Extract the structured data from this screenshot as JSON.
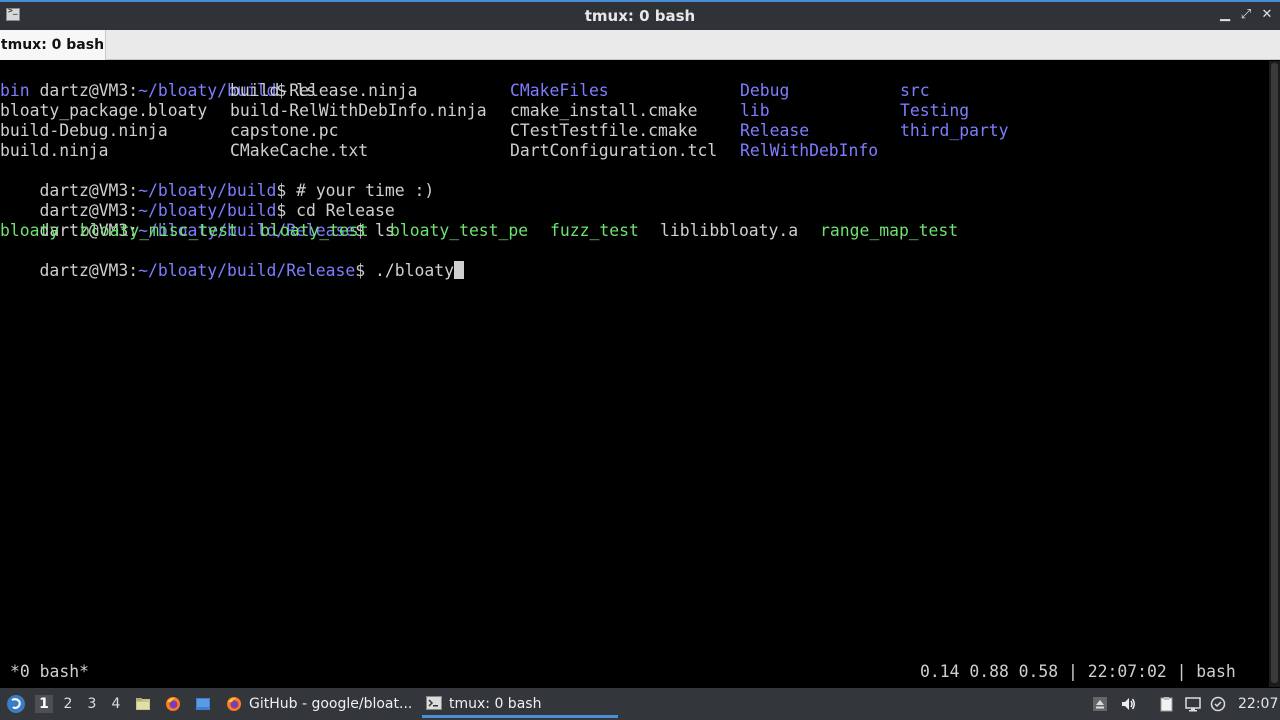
{
  "window": {
    "title": "tmux: 0 bash"
  },
  "tab": {
    "label": "tmux: 0 bash"
  },
  "terminal": {
    "prompt1": {
      "user": "dartz@VM3",
      "sep": ":",
      "path": "~/bloaty/build",
      "sign": "$ ",
      "cmd": "ls"
    },
    "ls_build": [
      [
        "bin",
        "build-Release.ninja",
        "CMakeFiles",
        "Debug",
        "src"
      ],
      [
        "bloaty_package.bloaty",
        "build-RelWithDebInfo.ninja",
        "cmake_install.cmake",
        "lib",
        "Testing"
      ],
      [
        "build-Debug.ninja",
        "capstone.pc",
        "CTestTestfile.cmake",
        "Release",
        "third_party"
      ],
      [
        "build.ninja",
        "CMakeCache.txt",
        "DartConfiguration.tcl",
        "RelWithDebInfo",
        ""
      ]
    ],
    "prompt2": {
      "user": "dartz@VM3",
      "sep": ":",
      "path": "~/bloaty/build",
      "sign": "$ ",
      "cmd": "# your time :)"
    },
    "prompt3": {
      "user": "dartz@VM3",
      "sep": ":",
      "path": "~/bloaty/build",
      "sign": "$ ",
      "cmd": "cd Release"
    },
    "prompt4": {
      "user": "dartz@VM3",
      "sep": ":",
      "path": "~/bloaty/build/Release",
      "sign": "$ ",
      "cmd": "ls"
    },
    "ls_release": [
      "bloaty",
      "bloaty_misc_test",
      "bloaty_test",
      "bloaty_test_pe",
      "fuzz_test",
      "liblibbloaty.a",
      "range_map_test"
    ],
    "prompt5": {
      "user": "dartz@VM3",
      "sep": ":",
      "path": "~/bloaty/build/Release",
      "sign": "$ ",
      "cmd": "./bloaty"
    }
  },
  "tmux_status": {
    "left": "*0 bash*",
    "right": "0.14 0.88 0.58 | 22:07:02 | bash"
  },
  "taskbar": {
    "workspaces": [
      "1",
      "2",
      "3",
      "4"
    ],
    "active_workspace": "1",
    "tasks": [
      {
        "label": "GitHub - google/bloat...",
        "icon": "firefox-icon"
      },
      {
        "label": "tmux: 0 bash",
        "icon": "terminal-icon"
      }
    ],
    "clock": "22:07"
  },
  "colors": {
    "dir": "#7d7dff",
    "exec": "#6de26d",
    "text": "#cfcfcf",
    "accent": "#4a8fd6"
  }
}
